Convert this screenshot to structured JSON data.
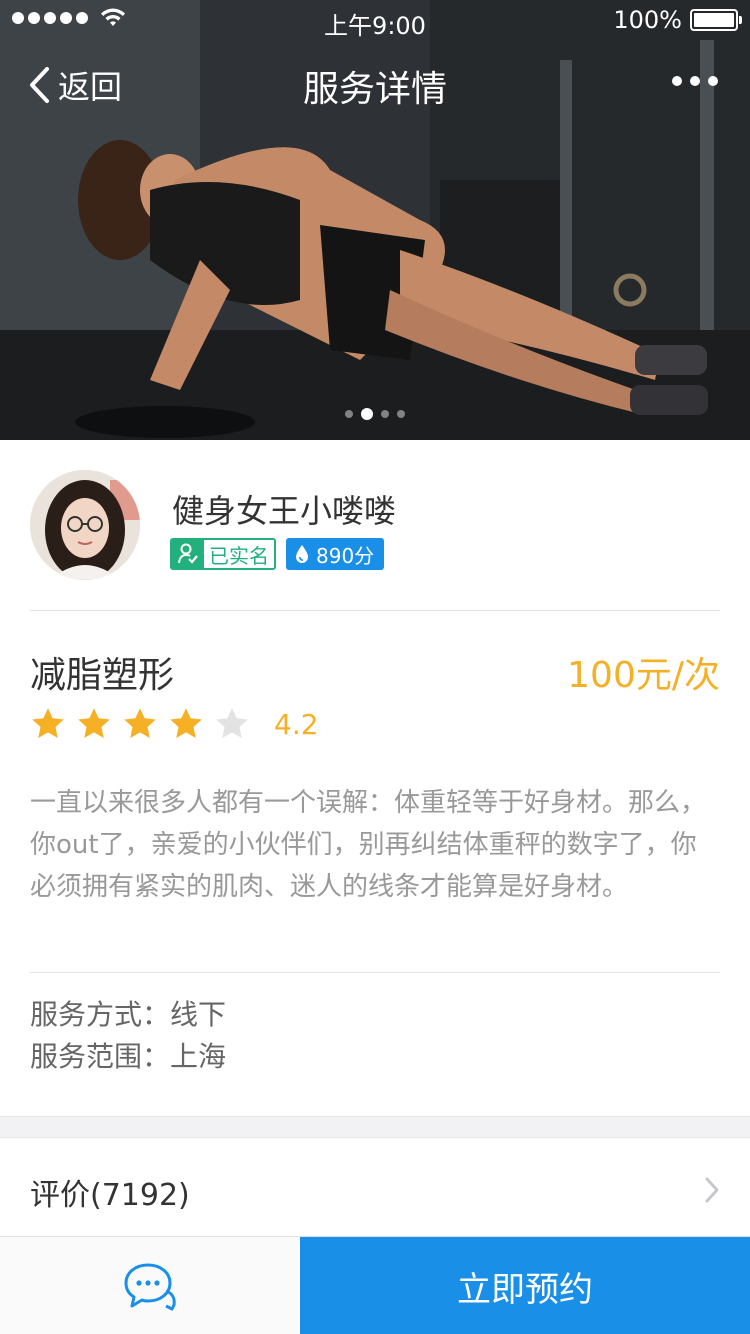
{
  "status_bar": {
    "time": "上午9:00",
    "battery": "100%"
  },
  "nav": {
    "back_label": "返回",
    "title": "服务详情"
  },
  "carousel": {
    "pages": 4,
    "active_index": 1
  },
  "provider": {
    "name": "健身女王小喽喽",
    "verified_label": "已实名",
    "score_label": "890分"
  },
  "service": {
    "title": "减脂塑形",
    "price": "100元/次",
    "rating_value": "4.2",
    "rating_stars": 4,
    "rating_max": 5,
    "description": "一直以来很多人都有一个误解：体重轻等于好身材。那么，你out了，亲爱的小伙伴们，别再纠结体重秤的数字了，你必须拥有紧实的肌肉、迷人的线条才能算是好身材。",
    "mode_line": "服务方式：线下",
    "area_line": "服务范围：上海"
  },
  "reviews": {
    "label": "评价(7192)"
  },
  "bottom": {
    "book_label": "立即预约"
  },
  "colors": {
    "accent_blue": "#1a8fe8",
    "accent_orange": "#f5b025",
    "verified_green": "#21b07e"
  }
}
